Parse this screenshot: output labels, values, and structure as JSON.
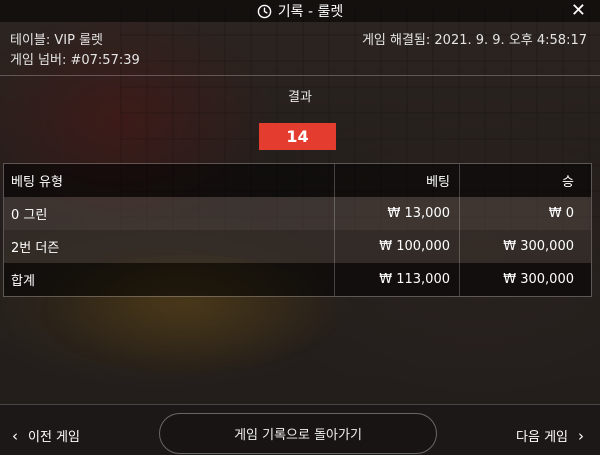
{
  "header": {
    "title": "기록 - 룰렛",
    "clock_icon": "clock-icon",
    "close_icon": "close-icon",
    "close_glyph": "✕"
  },
  "info": {
    "table": "테이블: VIP 룰렛",
    "game_number": "게임 넘버: #07:57:39",
    "resolved": "게임 해결됨: 2021. 9. 9. 오후 4:58:17"
  },
  "result": {
    "title": "결과",
    "number": "14",
    "number_color": "#e43c2f"
  },
  "bets_table": {
    "headers": [
      "베팅 유형",
      "베팅",
      "승"
    ],
    "rows": [
      [
        "0 그린",
        "₩ 13,000",
        "₩ 0"
      ],
      [
        "2번 더즌",
        "₩ 100,000",
        "₩ 300,000"
      ]
    ],
    "total": [
      "합계",
      "₩ 113,000",
      "₩ 300,000"
    ]
  },
  "footer": {
    "prev_label": "이전 게임",
    "prev_glyph": "‹",
    "back_label": "게임 기록으로 돌아가기",
    "next_label": "다음 게임",
    "next_glyph": "›"
  }
}
